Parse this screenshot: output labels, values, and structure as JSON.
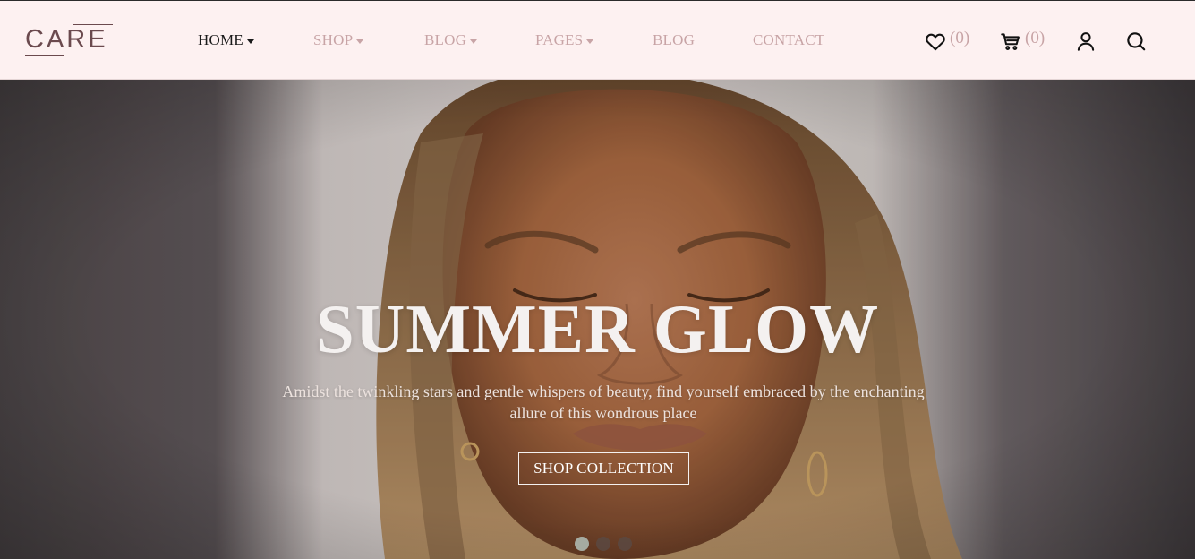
{
  "brand": {
    "logo_text": "CARE"
  },
  "nav": {
    "items": [
      {
        "label": "HOME",
        "has_dropdown": true,
        "active": true
      },
      {
        "label": "SHOP",
        "has_dropdown": true,
        "active": false
      },
      {
        "label": "BLOG",
        "has_dropdown": true,
        "active": false
      },
      {
        "label": "PAGES",
        "has_dropdown": true,
        "active": false
      },
      {
        "label": "BLOG",
        "has_dropdown": false,
        "active": false
      },
      {
        "label": "CONTACT",
        "has_dropdown": false,
        "active": false
      }
    ]
  },
  "header_actions": {
    "wishlist": {
      "icon": "heart-icon",
      "count": "(0)"
    },
    "cart": {
      "icon": "cart-icon",
      "count": "(0)"
    },
    "account": {
      "icon": "user-icon"
    },
    "search": {
      "icon": "search-icon"
    }
  },
  "hero": {
    "title": "SUMMER GLOW",
    "subtitle": "Amidst the twinkling stars and gentle whispers of beauty, find yourself embraced by the enchanting allure of this wondrous place",
    "cta_label": "SHOP COLLECTION",
    "slides": {
      "count": 3,
      "active_index": 0
    }
  },
  "colors": {
    "header_bg": "#fdf1f1",
    "nav_inactive": "#c8a4a6",
    "nav_active": "#1a1a1a",
    "logo": "#6b4a4e",
    "hero_text": "#f4f1f0"
  }
}
